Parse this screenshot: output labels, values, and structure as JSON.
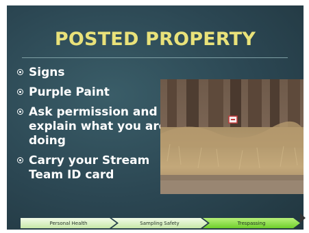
{
  "slide": {
    "title": "POSTED PROPERTY",
    "bullets": [
      "Signs",
      "Purple Paint",
      "Ask permission and explain what you are doing",
      "Carry your Stream Team ID card"
    ]
  },
  "nav": {
    "steps": [
      "Personal Health",
      "Sampling Safety",
      "Trespassing"
    ],
    "active_step": "Trespassing"
  },
  "colors": {
    "background": "#2b4652",
    "title": "#e9e27a",
    "nav_inactive": "#c7e8a8",
    "nav_active": "#6fcf2c"
  },
  "icons": [
    "bullet-icon",
    "slide-control-icon"
  ]
}
